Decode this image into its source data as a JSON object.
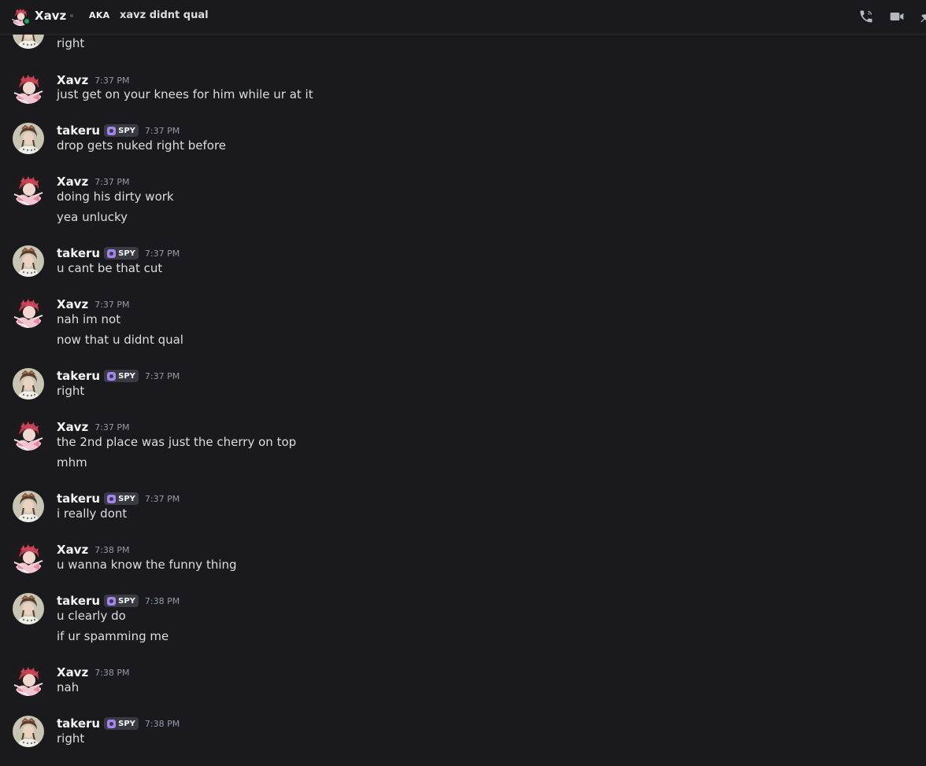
{
  "header": {
    "name": "Xavz",
    "aka_label": "AKA",
    "aka_text": "xavz didnt qual",
    "status_color": "#23a55a",
    "icons": [
      "voice-call-icon",
      "video-call-icon",
      "pin-icon"
    ]
  },
  "partial_top": {
    "text": "right"
  },
  "messages": [
    {
      "author": "Xavz",
      "time": "7:37 PM",
      "lines": [
        "just get on your knees for him while ur at it"
      ]
    },
    {
      "author": "takeru",
      "tag": "SPY",
      "time": "7:37 PM",
      "lines": [
        "drop gets nuked right before"
      ]
    },
    {
      "author": "Xavz",
      "time": "7:37 PM",
      "lines": [
        "doing his dirty work",
        "yea unlucky"
      ]
    },
    {
      "author": "takeru",
      "tag": "SPY",
      "time": "7:37 PM",
      "lines": [
        "u cant be that cut"
      ]
    },
    {
      "author": "Xavz",
      "time": "7:37 PM",
      "lines": [
        "nah im not",
        "now that u didnt qual"
      ]
    },
    {
      "author": "takeru",
      "tag": "SPY",
      "time": "7:37 PM",
      "lines": [
        "right"
      ]
    },
    {
      "author": "Xavz",
      "time": "7:37 PM",
      "lines": [
        "the 2nd place was just the cherry on top",
        "mhm"
      ]
    },
    {
      "author": "takeru",
      "tag": "SPY",
      "time": "7:37 PM",
      "lines": [
        "i really dont"
      ]
    },
    {
      "author": "Xavz",
      "time": "7:38 PM",
      "lines": [
        "u wanna know the funny thing"
      ]
    },
    {
      "author": "takeru",
      "tag": "SPY",
      "time": "7:38 PM",
      "lines": [
        "u clearly do",
        "if ur spamming me"
      ]
    },
    {
      "author": "Xavz",
      "time": "7:38 PM",
      "lines": [
        "nah"
      ]
    },
    {
      "author": "takeru",
      "tag": "SPY",
      "time": "7:38 PM",
      "lines": [
        "right"
      ]
    }
  ]
}
